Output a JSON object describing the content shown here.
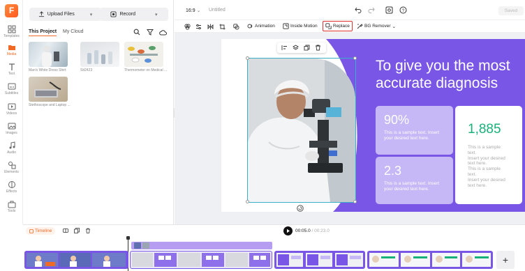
{
  "brand": {
    "logo_letter": "F",
    "accent": "#f06a25",
    "purple": "#7a56e6"
  },
  "rail": {
    "items": [
      {
        "label": "Templates",
        "icon": "grid-icon"
      },
      {
        "label": "Media",
        "icon": "folder-icon"
      },
      {
        "label": "Text",
        "icon": "text-icon"
      },
      {
        "label": "Subtitles",
        "icon": "subtitles-icon"
      },
      {
        "label": "Videos",
        "icon": "video-icon"
      },
      {
        "label": "Images",
        "icon": "image-icon"
      },
      {
        "label": "Audio",
        "icon": "music-icon"
      },
      {
        "label": "Elements",
        "icon": "shapes-icon"
      },
      {
        "label": "Effects",
        "icon": "effects-icon"
      },
      {
        "label": "Tools",
        "icon": "toolbox-icon"
      }
    ]
  },
  "media": {
    "upload_label": "Upload Files",
    "record_label": "Record",
    "tabs": [
      "This Project",
      "My Cloud"
    ],
    "items": [
      {
        "label": "Man's White Dress Shirt"
      },
      {
        "label": "Stt2423"
      },
      {
        "label": "Thermometer on Medical ..."
      },
      {
        "label": "Stethoscope and Laptop ..."
      }
    ]
  },
  "topbar": {
    "aspect_ratio": "16:9",
    "project_title": "Untitled",
    "saved_label": "Saved"
  },
  "toolbar": {
    "animation": "Animation",
    "inside_motion": "Inside Motion",
    "replace": "Replace",
    "bg_remover": "BG Remover"
  },
  "slide": {
    "heading_line1": "To give you the most",
    "heading_line2": "accurate diagnosis",
    "card1_value": "90%",
    "card1_text": "This is a sample text. Insert your desired text here.",
    "card2_value": "2.3",
    "card2_text": "This is a sample text. Insert your desired text here.",
    "card3_value": "1,885",
    "card3_lines": [
      "This is a sample text.",
      "Insert your desired",
      "text here.",
      "This is a sample text.",
      "Insert your desired",
      "text here."
    ]
  },
  "timeline": {
    "label": "Timeline",
    "current_time": "00:05.0",
    "total_time": "00:23.0",
    "add_label": "+"
  }
}
